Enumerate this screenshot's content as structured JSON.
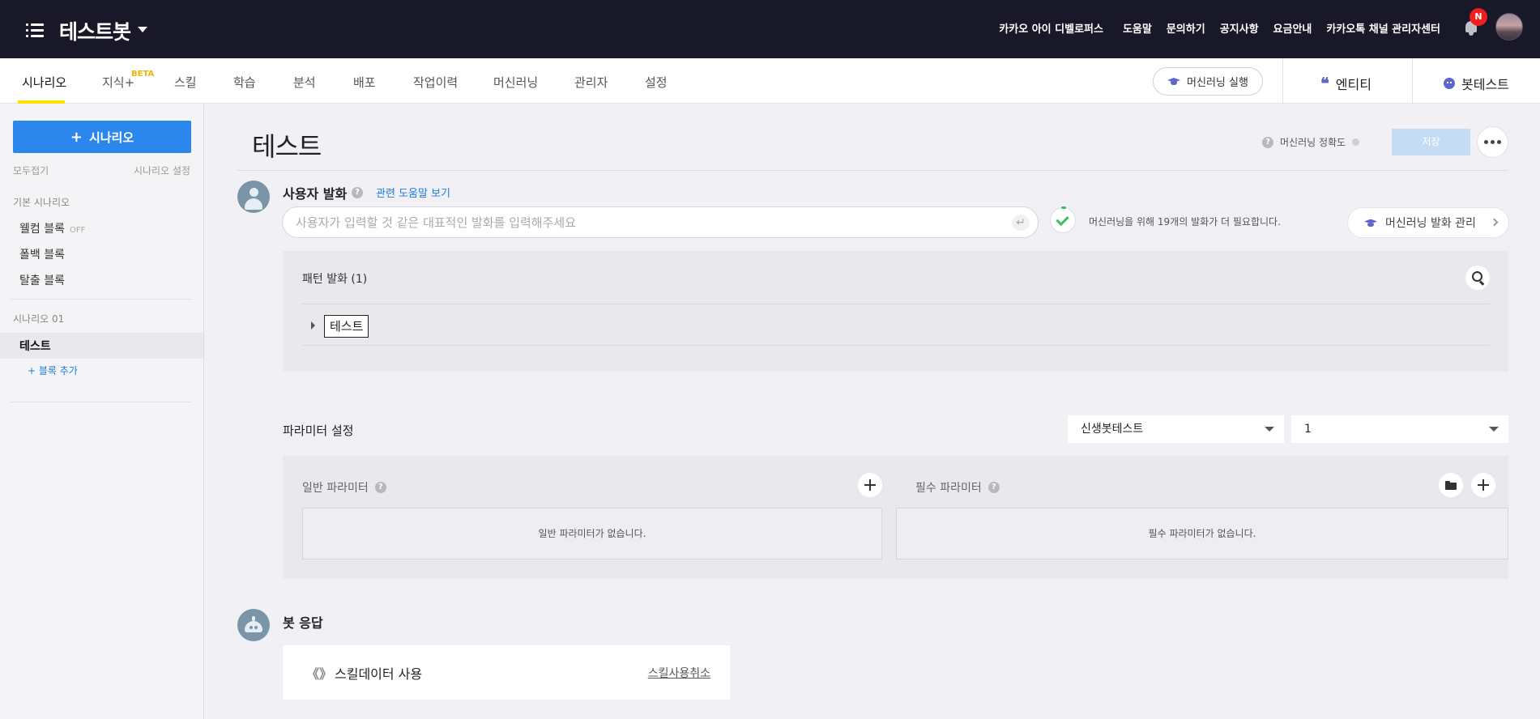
{
  "topbar": {
    "bot_name": "테스트봇",
    "links": [
      "카카오 아이 디벨로퍼스",
      "도움말",
      "문의하기",
      "공지사항",
      "요금안내",
      "카카오톡 채널 관리자센터"
    ],
    "notification_badge": "N"
  },
  "tabs": [
    "시나리오",
    "지식+",
    "스킬",
    "학습",
    "분석",
    "배포",
    "작업이력",
    "머신러닝",
    "관리자",
    "설정"
  ],
  "beta_label": "BETA",
  "active_tab": "시나리오",
  "ml_run_label": "머신러닝 실행",
  "entity_label": "엔티티",
  "bottest_label": "봇테스트",
  "sidebar": {
    "add_scenario": "시나리오",
    "collapse_all": "모두접기",
    "scenario_settings": "시나리오 설정",
    "basic_scenario": "기본 시나리오",
    "welcome_block": "웰컴 블록",
    "welcome_status": "OFF",
    "fallback_block": "폴백 블록",
    "exit_block": "탈출 블록",
    "scenario_group": "시나리오 01",
    "active_block": "테스트",
    "add_block": "+ 블록 추가"
  },
  "main": {
    "title": "테스트",
    "accuracy_label": "머신러닝 정확도",
    "save_label": "저장",
    "user_utterance_title": "사용자 발화",
    "help_link": "관련 도움말 보기",
    "input_placeholder": "사용자가 입력할 것 같은 대표적인 발화를 입력해주세요",
    "ml_note": "머신러닝을 위해 19개의 발화가 더 필요합니다.",
    "ml_manage_label": "머신러닝 발화 관리",
    "pattern_title": "패턴 발화 (1)",
    "pattern_item": "테스트",
    "param_title": "파라미터 설정",
    "select_bot": "신생봇테스트",
    "select_value": "1",
    "general_param": "일반 파라미터",
    "required_param": "필수 파라미터",
    "general_empty": "일반 파라미터가 없습니다.",
    "required_empty": "필수 파라미터가 없습니다.",
    "bot_response_title": "봇 응답",
    "skill_data_label": "스킬데이터 사용",
    "skill_cancel_label": "스킬사용취소"
  },
  "colors": {
    "topbar_bg": "#181828",
    "primary_blue": "#2b87ec",
    "accent_yellow": "#fde000",
    "link_blue": "#1f7be0",
    "badge_red": "#f01e1e"
  }
}
